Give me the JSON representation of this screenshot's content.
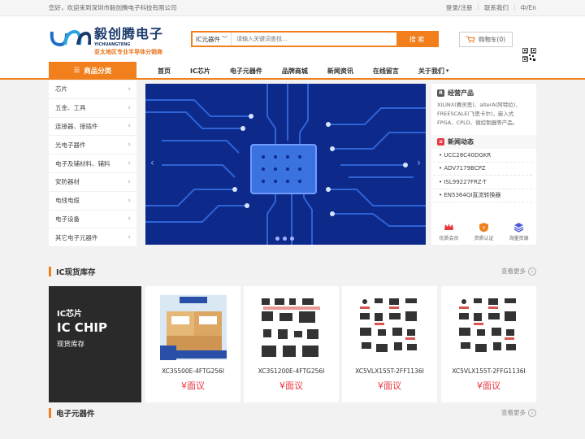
{
  "topbar": {
    "welcome": "您好，欢迎来到深圳市毅创腾电子科技有限公司",
    "login": "登录/注册",
    "contact": "联系我们",
    "lang": "中/En"
  },
  "logo": {
    "cn": "毅创腾电子",
    "en": "YICHUANGTENG",
    "sub": "亚太地区专业半导体分销商"
  },
  "search": {
    "category": "IC元器件",
    "placeholder": "请输入关键词查找...",
    "button": "搜 索"
  },
  "cart": {
    "label": "购物车(0)"
  },
  "nav": {
    "category_label": "商品分类",
    "items": [
      "首页",
      "IC芯片",
      "电子元器件",
      "品牌商城",
      "新闻资讯",
      "在线留言",
      "关于我们"
    ]
  },
  "sidebar": {
    "items": [
      "芯片",
      "五金、工具",
      "连接器、接插件",
      "光电子器件",
      "电子及辅材料、辅料",
      "安防器材",
      "电线电缆",
      "电子设备",
      "其它电子元器件"
    ]
  },
  "right_panel": {
    "products_title": "经营产品",
    "products_text": "XILINX(赛灵思)、alterA(阿特拉)、FREESCALE(飞思卡尔)，嵌入式FPGA、CPLD、微控制器等产品。",
    "news_title": "新闻动态",
    "news": [
      "UCC28C40DGKR",
      "ADV7179BCPZ",
      "ISL99227FRZ-T",
      "EN5364QI直流转换器"
    ],
    "icons": [
      {
        "name": "crown-icon",
        "label": "优质会员"
      },
      {
        "name": "certificate-icon",
        "label": "资质认证"
      },
      {
        "name": "layers-icon",
        "label": "海量资源"
      }
    ]
  },
  "section_ic": {
    "title": "IC现货库存",
    "more": "查看更多"
  },
  "feature": {
    "line1": "IC芯片",
    "line2": "IC CHIP",
    "line3": "现货库存"
  },
  "products": [
    {
      "name": "XC3S500E-4FTG256I",
      "price": "¥面议"
    },
    {
      "name": "XC3S1200E-4FTG256I",
      "price": "¥面议"
    },
    {
      "name": "XC5VLX155T-2FF1136I",
      "price": "¥面议"
    },
    {
      "name": "XC5VLX155T-2FFG1136I",
      "price": "¥面议"
    }
  ],
  "section_components": {
    "title": "电子元器件",
    "more": "查看更多"
  },
  "colors": {
    "accent": "#f07f1c",
    "price": "#e8373f",
    "banner": "#0d2a8a"
  }
}
